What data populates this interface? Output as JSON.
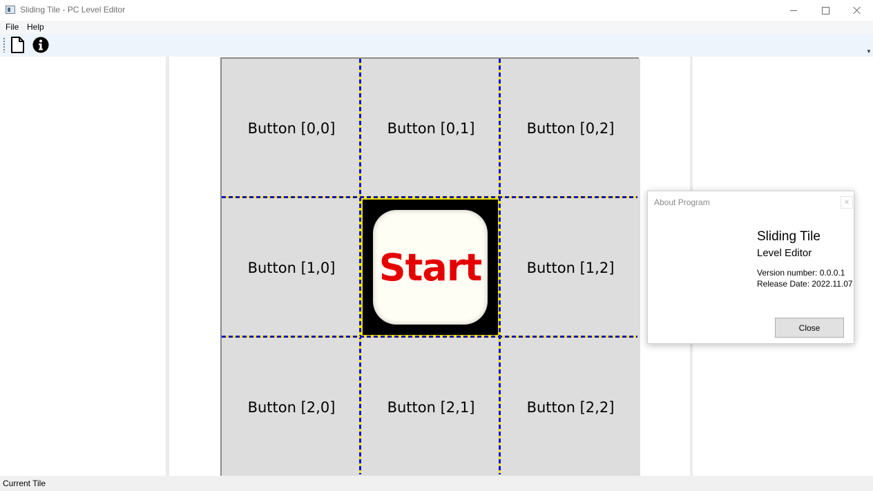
{
  "window": {
    "title": "Sliding Tile - PC Level Editor",
    "controls": {
      "minimize": "minimize",
      "maximize": "maximize",
      "close": "close"
    }
  },
  "menu": {
    "file": "File",
    "help": "Help"
  },
  "toolbar": {
    "icons": [
      "new-document-icon",
      "info-icon"
    ]
  },
  "grid": {
    "rows": 3,
    "cols": 3,
    "cells": [
      [
        "Button [0,0]",
        "Button [0,1]",
        "Button [0,2]"
      ],
      [
        "Button [1,0]",
        "Start",
        "Button [1,2]"
      ],
      [
        "Button [2,0]",
        "Button [2,1]",
        "Button [2,2]"
      ]
    ],
    "grid_line_colors": [
      "#1010c8",
      "#f2e600"
    ]
  },
  "start_tile": {
    "label": "Start",
    "label_color": "#e50000"
  },
  "about": {
    "title": "About Program",
    "app_name": "Sliding Tile",
    "subtitle": "Level Editor",
    "version": "Version number: 0.0.0.1",
    "release_date": "Release Date: 2022.11.07",
    "close_label": "Close"
  },
  "status": {
    "text": "Current Tile"
  }
}
